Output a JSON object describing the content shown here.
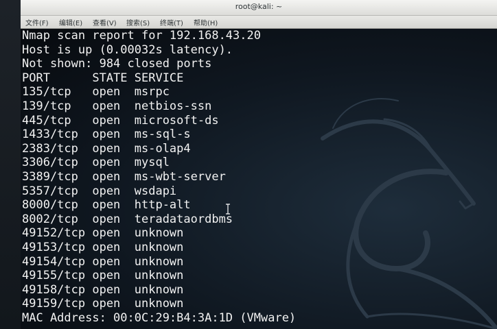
{
  "window": {
    "title": "root@kali: ~"
  },
  "menu": [
    {
      "label": "文件(F)"
    },
    {
      "label": "编辑(E)"
    },
    {
      "label": "查看(V)"
    },
    {
      "label": "搜索(S)"
    },
    {
      "label": "终端(T)"
    },
    {
      "label": "帮助(H)"
    }
  ],
  "terminal": {
    "lines": [
      "Nmap scan report for 192.168.43.20",
      "Host is up (0.00032s latency).",
      "Not shown: 984 closed ports",
      "PORT      STATE SERVICE",
      "135/tcp   open  msrpc",
      "139/tcp   open  netbios-ssn",
      "445/tcp   open  microsoft-ds",
      "1433/tcp  open  ms-sql-s",
      "2383/tcp  open  ms-olap4",
      "3306/tcp  open  mysql",
      "3389/tcp  open  ms-wbt-server",
      "5357/tcp  open  wsdapi",
      "8000/tcp  open  http-alt",
      "8002/tcp  open  teradataordbms",
      "49152/tcp open  unknown",
      "49153/tcp open  unknown",
      "49154/tcp open  unknown",
      "49155/tcp open  unknown",
      "49158/tcp open  unknown",
      "49159/tcp open  unknown",
      "MAC Address: 00:0C:29:B4:3A:1D (VMware)"
    ]
  },
  "colors": {
    "terminal_text": "#f2f2f2",
    "terminal_bg": "#0f1720",
    "titlebar_bg": "#e4e4e1"
  },
  "icons": {
    "background": "kali-dragon-icon",
    "pointer": "text-cursor-icon"
  }
}
